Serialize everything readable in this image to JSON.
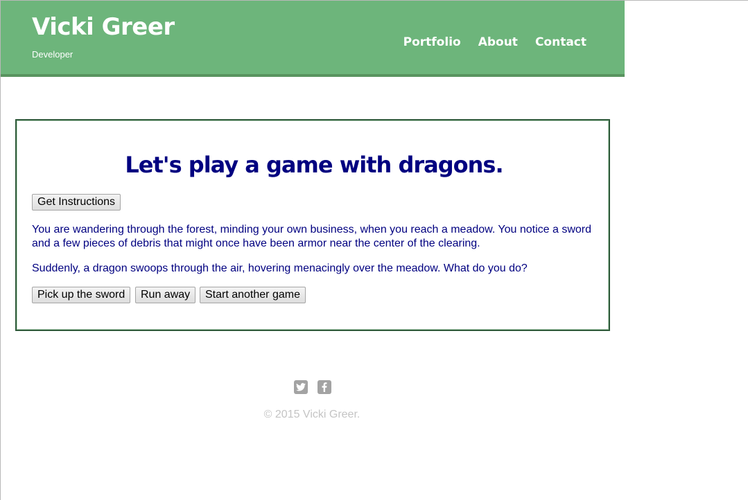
{
  "header": {
    "site_title": "Vicki Greer",
    "subtitle": "Developer",
    "nav": [
      {
        "label": "Portfolio"
      },
      {
        "label": "About"
      },
      {
        "label": "Contact"
      }
    ]
  },
  "game": {
    "title": "Let's play a game with dragons.",
    "instructions_button": "Get Instructions",
    "paragraphs": [
      "You are wandering through the forest, minding your own business, when you reach a meadow. You notice a sword and a few pieces of debris that might once have been armor near the center of the clearing.",
      "Suddenly, a dragon swoops through the air, hovering menacingly over the meadow. What do you do?"
    ],
    "choices": [
      {
        "label": "Pick up the sword"
      },
      {
        "label": "Run away"
      },
      {
        "label": "Start another game"
      }
    ]
  },
  "footer": {
    "icons": [
      "twitter-icon",
      "facebook-icon"
    ],
    "copyright": "© 2015 Vicki Greer."
  },
  "colors": {
    "header_bg": "#6db57b",
    "header_border": "#59945f",
    "game_text": "#000080",
    "panel_border": "#2f5a3a",
    "footer_text": "#c4c4c4",
    "icon_bg": "#a3a3a3"
  }
}
